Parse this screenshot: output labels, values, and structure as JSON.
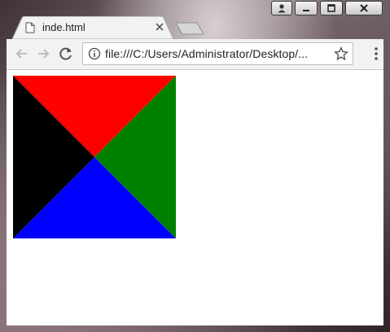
{
  "tab": {
    "title": "inde.html"
  },
  "address_bar": {
    "url": "file:///C:/Users/Administrator/Desktop/..."
  },
  "page": {
    "colors": {
      "top": "#ff0000",
      "right": "#008000",
      "bottom": "#0000ff",
      "left": "#000000"
    }
  }
}
